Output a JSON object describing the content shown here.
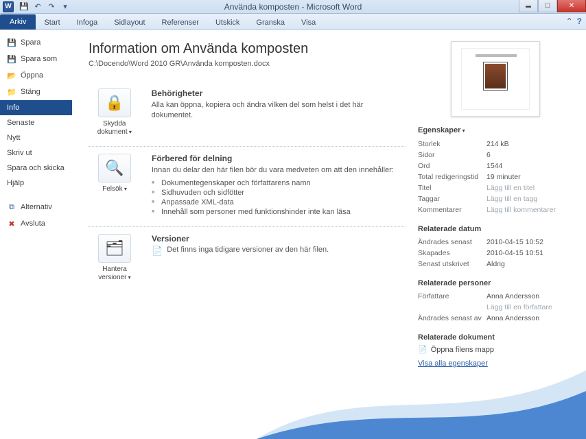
{
  "title": "Använda komposten - Microsoft Word",
  "ribbon": {
    "file": "Arkiv",
    "tabs": [
      "Start",
      "Infoga",
      "Sidlayout",
      "Referenser",
      "Utskick",
      "Granska",
      "Visa"
    ]
  },
  "nav": {
    "save": "Spara",
    "save_as": "Spara som",
    "open": "Öppna",
    "close": "Stäng",
    "info": "Info",
    "recent": "Senaste",
    "new": "Nytt",
    "print": "Skriv ut",
    "share": "Spara och skicka",
    "help": "Hjälp",
    "options": "Alternativ",
    "exit": "Avsluta"
  },
  "heading": "Information om Använda komposten",
  "path": "C:\\Docendo\\Word 2010 GR\\Använda komposten.docx",
  "permissions": {
    "btn": "Skydda dokument",
    "title": "Behörigheter",
    "text": "Alla kan öppna, kopiera och ändra vilken del som helst i det här dokumentet."
  },
  "prepare": {
    "btn": "Felsök",
    "title": "Förbered för delning",
    "intro": "Innan du delar den här filen bör du vara medveten om att den innehåller:",
    "items": [
      "Dokumentegenskaper och författarens namn",
      "Sidhuvuden och sidfötter",
      "Anpassade XML-data",
      "Innehåll som personer med funktionshinder inte kan läsa"
    ]
  },
  "versions": {
    "btn": "Hantera versioner",
    "title": "Versioner",
    "text": "Det finns inga tidigare versioner av den här filen."
  },
  "props": {
    "header": "Egenskaper",
    "size_l": "Storlek",
    "size_v": "214 kB",
    "pages_l": "Sidor",
    "pages_v": "6",
    "words_l": "Ord",
    "words_v": "1544",
    "edit_l": "Total redigeringstid",
    "edit_v": "19 minuter",
    "title_l": "Titel",
    "title_v": "Lägg till en titel",
    "tags_l": "Taggar",
    "tags_v": "Lägg till en tagg",
    "comm_l": "Kommentarer",
    "comm_v": "Lägg till kommentarer"
  },
  "dates": {
    "header": "Relaterade datum",
    "mod_l": "Ändrades senast",
    "mod_v": "2010-04-15 10:52",
    "cre_l": "Skapades",
    "cre_v": "2010-04-15 10:51",
    "prt_l": "Senast utskrivet",
    "prt_v": "Aldrig"
  },
  "people": {
    "header": "Relaterade personer",
    "auth_l": "Författare",
    "auth_v": "Anna Andersson",
    "add_auth": "Lägg till en författare",
    "lastmod_l": "Ändrades senast av",
    "lastmod_v": "Anna Andersson"
  },
  "docs": {
    "header": "Relaterade dokument",
    "open_folder": "Öppna filens mapp",
    "all_props": "Visa alla egenskaper"
  }
}
